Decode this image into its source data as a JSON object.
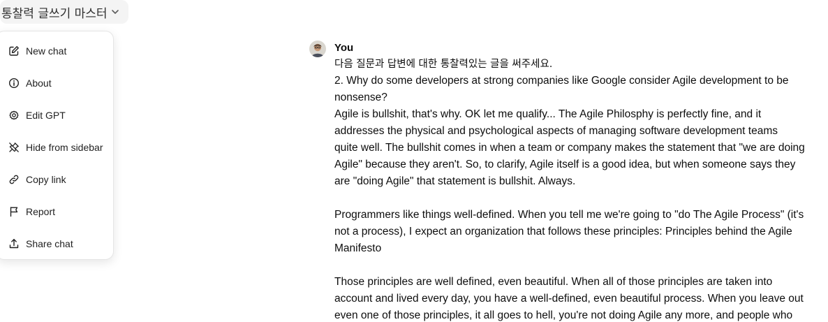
{
  "header": {
    "gpt_name": "통찰력 글쓰기 마스터"
  },
  "menu": {
    "items": [
      {
        "label": "New chat",
        "icon": "pencil-square-icon"
      },
      {
        "label": "About",
        "icon": "info-circle-icon"
      },
      {
        "label": "Edit GPT",
        "icon": "gear-icon"
      },
      {
        "label": "Hide from sidebar",
        "icon": "pin-off-icon"
      },
      {
        "label": "Copy link",
        "icon": "link-icon"
      },
      {
        "label": "Report",
        "icon": "flag-icon"
      },
      {
        "label": "Share chat",
        "icon": "share-icon"
      }
    ]
  },
  "message": {
    "author": "You",
    "lines": [
      "다음 질문과 답변에 대한 통찰력있는 글을 써주세요.",
      "2.  Why do some developers at strong companies like Google consider Agile development to be",
      "nonsense?",
      "Agile is bullshit, that's why. OK let me qualify... The Agile Philosphy is perfectly fine, and it",
      "addresses the physical and psychological aspects of managing software development teams",
      "quite well. The bullshit comes in when a team or company makes the statement that \"we are doing",
      "Agile\" because they aren't. So, to clarify, Agile itself is a good idea, but when someone says they",
      "are \"doing Agile\" that statement is bullshit. Always.",
      "",
      "Programmers like things well-defined. When you tell me we're going to \"do The Agile Process\" (it's",
      "not a process), I expect an organization that follows these principles: Principles behind the Agile",
      "Manifesto",
      "",
      "Those principles are well defined, even beautiful. When all of those principles are taken into",
      "account and lived every day, you have a well-defined, even beautiful process. When you leave out",
      "even one of those principles, it all goes to hell, you're not doing Agile any more, and people who"
    ]
  }
}
